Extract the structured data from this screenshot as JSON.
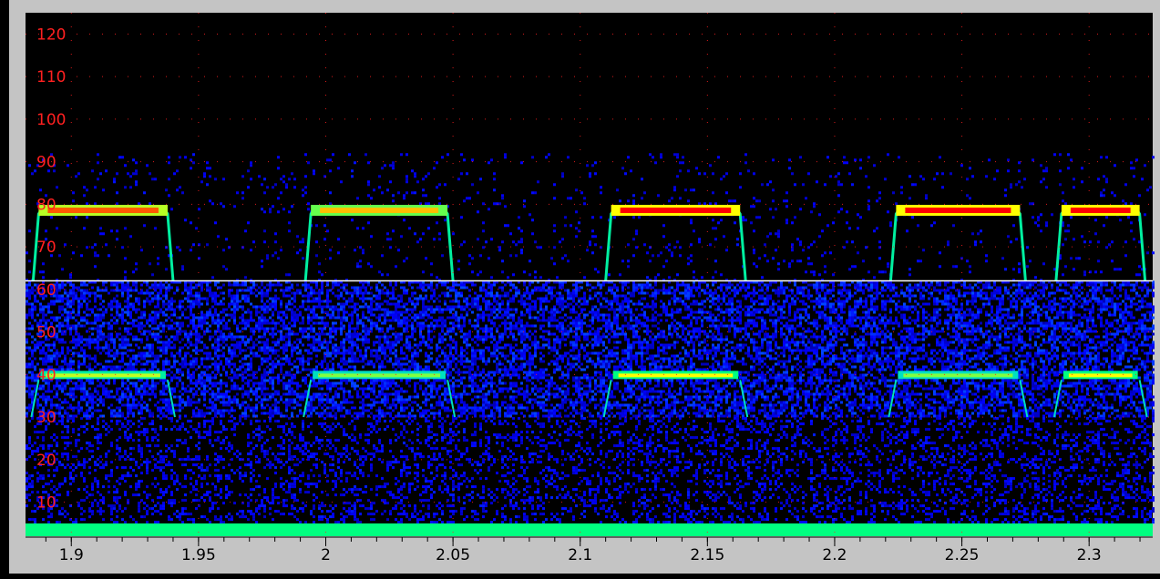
{
  "window": {
    "title": ""
  },
  "chart_data": {
    "type": "heatmap",
    "title": "",
    "xlabel": "",
    "ylabel": "",
    "xlim": [
      1.882,
      2.325
    ],
    "ylim": [
      2,
      125
    ],
    "x_ticks": [
      1.9,
      1.95,
      2,
      2.05,
      2.1,
      2.15,
      2.2,
      2.25,
      2.3
    ],
    "x_tick_labels": [
      "1.9",
      "1.95",
      "2",
      "2.05",
      "2.1",
      "2.15",
      "2.2",
      "2.25",
      "2.3"
    ],
    "y_ticks": [
      10,
      20,
      30,
      40,
      50,
      60,
      70,
      80,
      90,
      100,
      110,
      120
    ],
    "y_tick_labels": [
      "10",
      "20",
      "30",
      "40",
      "50",
      "60",
      "70",
      "80",
      "90",
      "100",
      "110",
      "120"
    ],
    "grid": true,
    "grid_style": "dotted-red",
    "threshold_line": {
      "value": 62
    },
    "colors": {
      "background": "#000000",
      "tick_label": "#ff2020",
      "grid": "#ff2020",
      "threshold": "#ffffff",
      "panel": "#c4c4c4",
      "axis_text": "#000000"
    },
    "colormap": [
      "#000060",
      "#0000ff",
      "#00c0ff",
      "#00ff80",
      "#ffff00",
      "#ff0000"
    ],
    "calls": [
      {
        "start": 1.885,
        "end": 1.94,
        "harmonic_1": {
          "freq": 79,
          "intensity": 0.93
        },
        "harmonic_2": {
          "freq": 40,
          "intensity": 0.55
        }
      },
      {
        "start": 1.992,
        "end": 2.05,
        "harmonic_1": {
          "freq": 79,
          "intensity": 0.85
        },
        "harmonic_2": {
          "freq": 40,
          "intensity": 0.5
        }
      },
      {
        "start": 2.11,
        "end": 2.165,
        "harmonic_1": {
          "freq": 79,
          "intensity": 1.0
        },
        "harmonic_2": {
          "freq": 40,
          "intensity": 0.6
        }
      },
      {
        "start": 2.222,
        "end": 2.275,
        "harmonic_1": {
          "freq": 79,
          "intensity": 1.0
        },
        "harmonic_2": {
          "freq": 40,
          "intensity": 0.5
        }
      },
      {
        "start": 2.287,
        "end": 2.322,
        "harmonic_1": {
          "freq": 79,
          "intensity": 1.0
        },
        "harmonic_2": {
          "freq": 40,
          "intensity": 0.6
        }
      }
    ],
    "noise_band": {
      "from": 30,
      "to": 62,
      "intensity": 0.35
    },
    "baseline_band": {
      "from": 2,
      "to": 5,
      "intensity": 0.6
    }
  }
}
